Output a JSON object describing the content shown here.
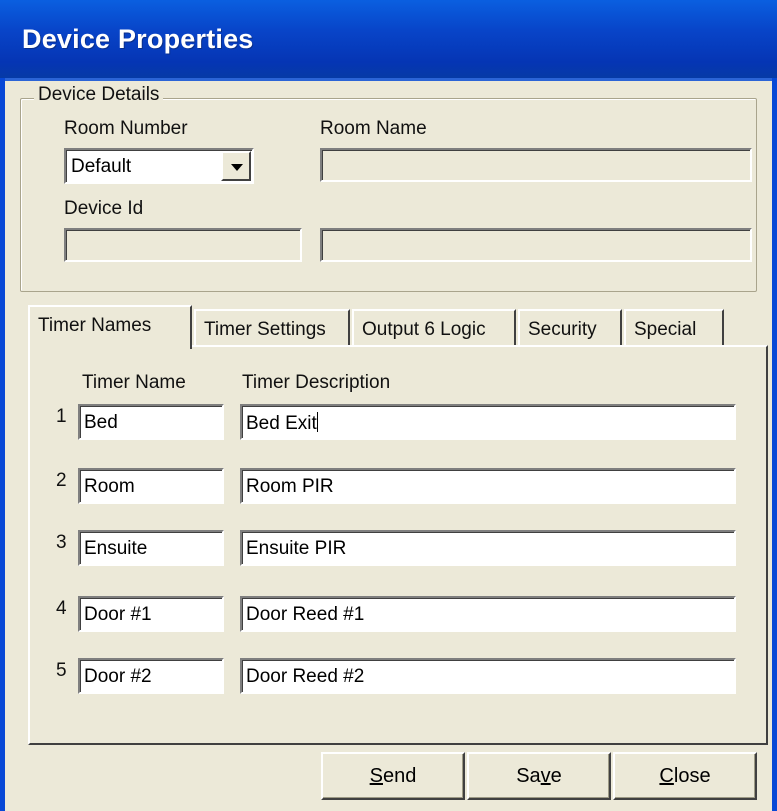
{
  "window": {
    "title": "Device Properties"
  },
  "device_details": {
    "legend": "Device Details",
    "room_number_label": "Room Number",
    "room_number_value": "Default",
    "room_name_label": "Room Name",
    "room_name_value": "",
    "device_id_label": "Device Id",
    "device_id_value": "",
    "device_extra_value": ""
  },
  "tabs": [
    {
      "label": "Timer Names",
      "active": true
    },
    {
      "label": "Timer Settings",
      "active": false
    },
    {
      "label": "Output 6 Logic",
      "active": false
    },
    {
      "label": "Security",
      "active": false
    },
    {
      "label": "Special",
      "active": false
    }
  ],
  "timer_table": {
    "col_name_header": "Timer Name",
    "col_desc_header": "Timer Description",
    "rows": [
      {
        "num": "1",
        "name": "Bed",
        "description": "Bed Exit"
      },
      {
        "num": "2",
        "name": "Room",
        "description": "Room PIR"
      },
      {
        "num": "3",
        "name": "Ensuite",
        "description": "Ensuite PIR"
      },
      {
        "num": "4",
        "name": "Door #1",
        "description": "Door Reed #1"
      },
      {
        "num": "5",
        "name": "Door #2",
        "description": "Door Reed #2"
      }
    ]
  },
  "buttons": {
    "send": {
      "pre": "",
      "mnemonic": "S",
      "post": "end"
    },
    "save": {
      "pre": "Sa",
      "mnemonic": "v",
      "post": "e"
    },
    "close": {
      "pre": "",
      "mnemonic": "C",
      "post": "lose"
    }
  },
  "colors": {
    "titlebar": "#0844c8",
    "face": "#ece9d8"
  }
}
